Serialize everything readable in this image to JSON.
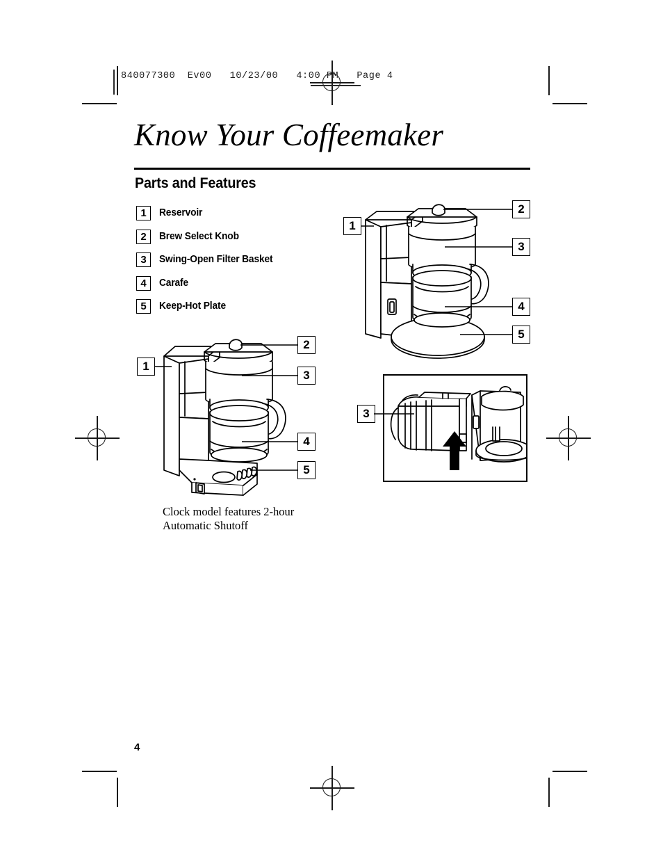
{
  "header": {
    "slug": "840077300  Ev00   10/23/00   4:00 PM   Page 4"
  },
  "title": "Know Your Coffeemaker",
  "section": {
    "heading": "Parts and Features"
  },
  "legend": {
    "items": [
      {
        "number": "1",
        "label": "Reservoir"
      },
      {
        "number": "2",
        "label": "Brew Select Knob"
      },
      {
        "number": "3",
        "label": "Swing-Open Filter Basket"
      },
      {
        "number": "4",
        "label": "Carafe"
      },
      {
        "number": "5",
        "label": "Keep-Hot Plate"
      }
    ]
  },
  "figures": {
    "clock_model": {
      "name": "Clock model coffeemaker illustration",
      "callouts": [
        "1",
        "2",
        "3",
        "4",
        "5"
      ],
      "caption_line1": "Clock model features 2-hour",
      "caption_line2": "Automatic Shutoff"
    },
    "basic_model": {
      "name": "Basic model coffeemaker illustration",
      "callouts": [
        "1",
        "2",
        "3",
        "4",
        "5"
      ]
    },
    "filter_detail": {
      "name": "Swing-open filter basket detail",
      "callouts": [
        "3"
      ]
    }
  },
  "footer": {
    "page_number": "4"
  },
  "colors": {
    "ink": "#000000",
    "paper": "#ffffff",
    "mark": "#1a1a1a"
  }
}
